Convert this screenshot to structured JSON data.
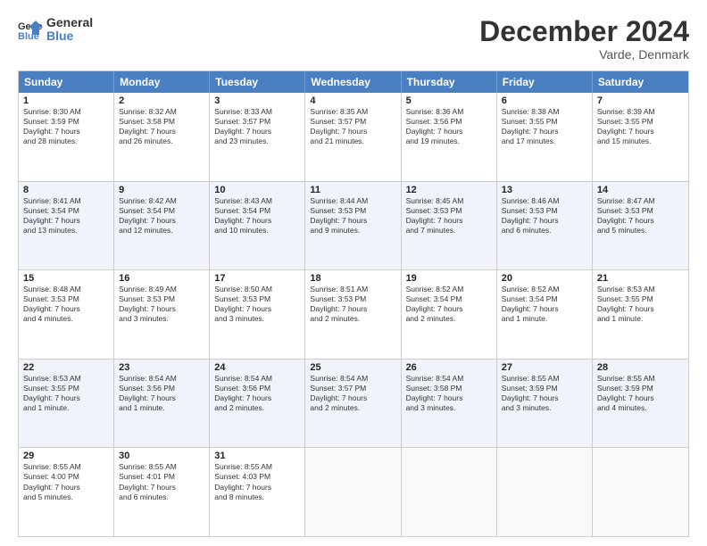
{
  "header": {
    "logo_general": "General",
    "logo_blue": "Blue",
    "month_title": "December 2024",
    "location": "Varde, Denmark"
  },
  "days_of_week": [
    "Sunday",
    "Monday",
    "Tuesday",
    "Wednesday",
    "Thursday",
    "Friday",
    "Saturday"
  ],
  "weeks": [
    {
      "alt": false,
      "cells": [
        {
          "day": "1",
          "lines": [
            "Sunrise: 8:30 AM",
            "Sunset: 3:59 PM",
            "Daylight: 7 hours",
            "and 28 minutes."
          ]
        },
        {
          "day": "2",
          "lines": [
            "Sunrise: 8:32 AM",
            "Sunset: 3:58 PM",
            "Daylight: 7 hours",
            "and 26 minutes."
          ]
        },
        {
          "day": "3",
          "lines": [
            "Sunrise: 8:33 AM",
            "Sunset: 3:57 PM",
            "Daylight: 7 hours",
            "and 23 minutes."
          ]
        },
        {
          "day": "4",
          "lines": [
            "Sunrise: 8:35 AM",
            "Sunset: 3:57 PM",
            "Daylight: 7 hours",
            "and 21 minutes."
          ]
        },
        {
          "day": "5",
          "lines": [
            "Sunrise: 8:36 AM",
            "Sunset: 3:56 PM",
            "Daylight: 7 hours",
            "and 19 minutes."
          ]
        },
        {
          "day": "6",
          "lines": [
            "Sunrise: 8:38 AM",
            "Sunset: 3:55 PM",
            "Daylight: 7 hours",
            "and 17 minutes."
          ]
        },
        {
          "day": "7",
          "lines": [
            "Sunrise: 8:39 AM",
            "Sunset: 3:55 PM",
            "Daylight: 7 hours",
            "and 15 minutes."
          ]
        }
      ]
    },
    {
      "alt": true,
      "cells": [
        {
          "day": "8",
          "lines": [
            "Sunrise: 8:41 AM",
            "Sunset: 3:54 PM",
            "Daylight: 7 hours",
            "and 13 minutes."
          ]
        },
        {
          "day": "9",
          "lines": [
            "Sunrise: 8:42 AM",
            "Sunset: 3:54 PM",
            "Daylight: 7 hours",
            "and 12 minutes."
          ]
        },
        {
          "day": "10",
          "lines": [
            "Sunrise: 8:43 AM",
            "Sunset: 3:54 PM",
            "Daylight: 7 hours",
            "and 10 minutes."
          ]
        },
        {
          "day": "11",
          "lines": [
            "Sunrise: 8:44 AM",
            "Sunset: 3:53 PM",
            "Daylight: 7 hours",
            "and 9 minutes."
          ]
        },
        {
          "day": "12",
          "lines": [
            "Sunrise: 8:45 AM",
            "Sunset: 3:53 PM",
            "Daylight: 7 hours",
            "and 7 minutes."
          ]
        },
        {
          "day": "13",
          "lines": [
            "Sunrise: 8:46 AM",
            "Sunset: 3:53 PM",
            "Daylight: 7 hours",
            "and 6 minutes."
          ]
        },
        {
          "day": "14",
          "lines": [
            "Sunrise: 8:47 AM",
            "Sunset: 3:53 PM",
            "Daylight: 7 hours",
            "and 5 minutes."
          ]
        }
      ]
    },
    {
      "alt": false,
      "cells": [
        {
          "day": "15",
          "lines": [
            "Sunrise: 8:48 AM",
            "Sunset: 3:53 PM",
            "Daylight: 7 hours",
            "and 4 minutes."
          ]
        },
        {
          "day": "16",
          "lines": [
            "Sunrise: 8:49 AM",
            "Sunset: 3:53 PM",
            "Daylight: 7 hours",
            "and 3 minutes."
          ]
        },
        {
          "day": "17",
          "lines": [
            "Sunrise: 8:50 AM",
            "Sunset: 3:53 PM",
            "Daylight: 7 hours",
            "and 3 minutes."
          ]
        },
        {
          "day": "18",
          "lines": [
            "Sunrise: 8:51 AM",
            "Sunset: 3:53 PM",
            "Daylight: 7 hours",
            "and 2 minutes."
          ]
        },
        {
          "day": "19",
          "lines": [
            "Sunrise: 8:52 AM",
            "Sunset: 3:54 PM",
            "Daylight: 7 hours",
            "and 2 minutes."
          ]
        },
        {
          "day": "20",
          "lines": [
            "Sunrise: 8:52 AM",
            "Sunset: 3:54 PM",
            "Daylight: 7 hours",
            "and 1 minute."
          ]
        },
        {
          "day": "21",
          "lines": [
            "Sunrise: 8:53 AM",
            "Sunset: 3:55 PM",
            "Daylight: 7 hours",
            "and 1 minute."
          ]
        }
      ]
    },
    {
      "alt": true,
      "cells": [
        {
          "day": "22",
          "lines": [
            "Sunrise: 8:53 AM",
            "Sunset: 3:55 PM",
            "Daylight: 7 hours",
            "and 1 minute."
          ]
        },
        {
          "day": "23",
          "lines": [
            "Sunrise: 8:54 AM",
            "Sunset: 3:56 PM",
            "Daylight: 7 hours",
            "and 1 minute."
          ]
        },
        {
          "day": "24",
          "lines": [
            "Sunrise: 8:54 AM",
            "Sunset: 3:56 PM",
            "Daylight: 7 hours",
            "and 2 minutes."
          ]
        },
        {
          "day": "25",
          "lines": [
            "Sunrise: 8:54 AM",
            "Sunset: 3:57 PM",
            "Daylight: 7 hours",
            "and 2 minutes."
          ]
        },
        {
          "day": "26",
          "lines": [
            "Sunrise: 8:54 AM",
            "Sunset: 3:58 PM",
            "Daylight: 7 hours",
            "and 3 minutes."
          ]
        },
        {
          "day": "27",
          "lines": [
            "Sunrise: 8:55 AM",
            "Sunset: 3:59 PM",
            "Daylight: 7 hours",
            "and 3 minutes."
          ]
        },
        {
          "day": "28",
          "lines": [
            "Sunrise: 8:55 AM",
            "Sunset: 3:59 PM",
            "Daylight: 7 hours",
            "and 4 minutes."
          ]
        }
      ]
    },
    {
      "alt": false,
      "cells": [
        {
          "day": "29",
          "lines": [
            "Sunrise: 8:55 AM",
            "Sunset: 4:00 PM",
            "Daylight: 7 hours",
            "and 5 minutes."
          ]
        },
        {
          "day": "30",
          "lines": [
            "Sunrise: 8:55 AM",
            "Sunset: 4:01 PM",
            "Daylight: 7 hours",
            "and 6 minutes."
          ]
        },
        {
          "day": "31",
          "lines": [
            "Sunrise: 8:55 AM",
            "Sunset: 4:03 PM",
            "Daylight: 7 hours",
            "and 8 minutes."
          ]
        },
        {
          "day": "",
          "lines": []
        },
        {
          "day": "",
          "lines": []
        },
        {
          "day": "",
          "lines": []
        },
        {
          "day": "",
          "lines": []
        }
      ]
    }
  ]
}
